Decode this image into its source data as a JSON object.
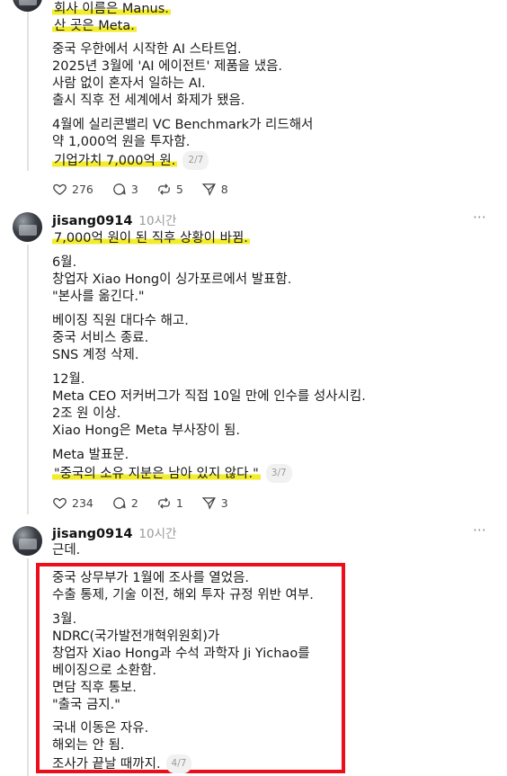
{
  "post1": {
    "lines": [
      "회사 이름은 Manus.",
      "산 곳은 Meta.",
      "중국 우한에서 시작한 AI 스타트업.",
      "2025년 3월에 'AI 에이전트' 제품을 냈음.",
      "사람 없이 혼자서 일하는 AI.",
      "출시 직후 전 세계에서 화제가 됐음.",
      "4월에 실리콘밸리 VC Benchmark가 리드해서",
      "약 1,000억 원을 투자함.",
      "기업가치 7,000억 원."
    ],
    "page": "2/7",
    "likes": "276",
    "comments": "3",
    "reposts": "5",
    "shares": "8"
  },
  "post2": {
    "username": "jisang0914",
    "time": "10시간",
    "lines": [
      "7,000억 원이 된 직후 상황이 바뀜.",
      "6월.",
      "창업자 Xiao Hong이 싱가포르에서 발표함.",
      "\"본사를 옮긴다.\"",
      "베이징 직원 대다수 해고.",
      "중국 서비스 종료.",
      "SNS 계정 삭제.",
      "12월.",
      "Meta CEO 저커버그가 직접 10일 만에 인수를 성사시킴.",
      "2조 원 이상.",
      "Xiao Hong은 Meta 부사장이 됨.",
      "Meta 발표문.",
      "\"중국의 소유 지분은 남아 있지 않다.\""
    ],
    "page": "3/7",
    "likes": "234",
    "comments": "2",
    "reposts": "1",
    "shares": "3"
  },
  "post3": {
    "username": "jisang0914",
    "time": "10시간",
    "lines": [
      "근데.",
      "중국 상무부가 1월에 조사를 열었음.",
      "수출 통제, 기술 이전, 해외 투자 규정 위반 여부.",
      "3월.",
      "NDRC(국가발전개혁위원회)가",
      "창업자 Xiao Hong과 수석 과학자 Ji Yichao를",
      "베이징으로 소환함.",
      "면담 직후 통보.",
      "\"출국 금지.\"",
      "국내 이동은 자유.",
      "해외는 안 됨.",
      "조사가 끝날 때까지."
    ],
    "page": "4/7"
  },
  "icons": {
    "more": "⋯",
    "like": "heart-icon",
    "comment": "comment-icon",
    "repost": "repost-icon",
    "share": "share-icon"
  },
  "colors": {
    "highlight": "#f3ec2b",
    "red_box": "#ec0e1a",
    "muted": "#9a9a9a"
  }
}
